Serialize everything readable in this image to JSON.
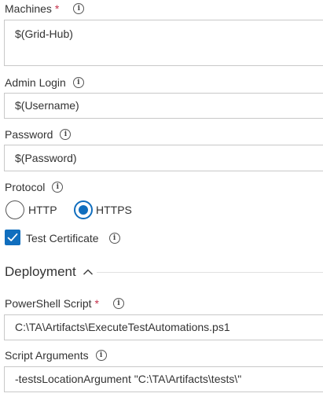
{
  "machines": {
    "label": "Machines",
    "required_mark": "*",
    "value": "$(Grid-Hub)"
  },
  "admin_login": {
    "label": "Admin Login",
    "value": "$(Username)"
  },
  "password": {
    "label": "Password",
    "value": "$(Password)"
  },
  "protocol": {
    "label": "Protocol",
    "options": [
      "HTTP",
      "HTTPS"
    ],
    "selected": "HTTPS"
  },
  "test_certificate": {
    "label": "Test Certificate",
    "checked": true
  },
  "deployment_section": {
    "title": "Deployment",
    "expanded": true
  },
  "powershell_script": {
    "label": "PowerShell Script",
    "required_mark": "*",
    "value": "C:\\TA\\Artifacts\\ExecuteTestAutomations.ps1"
  },
  "script_arguments": {
    "label": "Script Arguments",
    "value": "-testsLocationArgument \"C:\\TA\\Artifacts\\tests\\\""
  },
  "icons": {
    "info": "info-icon",
    "check": "checkmark-icon",
    "chevron": "chevron-up-icon"
  },
  "colors": {
    "accent": "#106ebe",
    "required": "#c4314b",
    "border": "#c8c8c8"
  }
}
